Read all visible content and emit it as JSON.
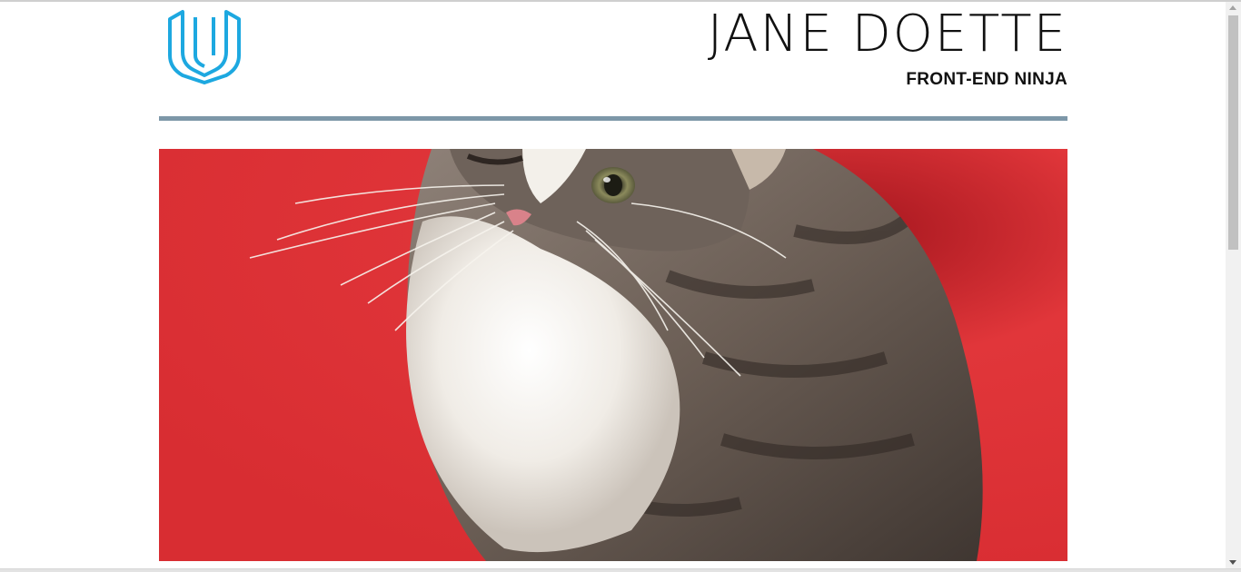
{
  "header": {
    "logo_icon": "udacity-logo-icon",
    "name": "JANE DOETTE",
    "role": "FRONT-END NINJA"
  },
  "hero": {
    "image_subject": "kitten on red background"
  },
  "colors": {
    "logo": "#1da8e0",
    "divider": "#7d97a8",
    "hero_background": "#d92f33",
    "text": "#111111"
  }
}
